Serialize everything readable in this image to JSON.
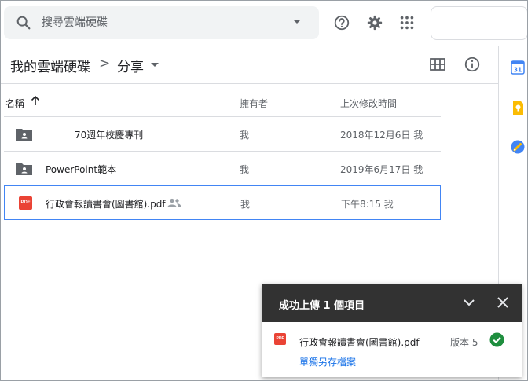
{
  "search": {
    "placeholder": "搜尋雲端硬碟"
  },
  "header": {
    "help_icon": "help-circle-icon",
    "settings_icon": "gear-icon",
    "apps_icon": "apps-grid-icon"
  },
  "breadcrumb": {
    "root": "我的雲端硬碟",
    "separator": ">",
    "current": "分享"
  },
  "columns": {
    "name": "名稱",
    "owner": "擁有者",
    "modified": "上次修改時間"
  },
  "files": [
    {
      "type": "shared-folder",
      "name": "70週年校慶專刊",
      "owner": "我",
      "modified": "2018年12月6日 我"
    },
    {
      "type": "shared-folder",
      "name": "PowerPoint範本",
      "owner": "我",
      "modified": "2019年6月17日 我"
    },
    {
      "type": "pdf",
      "name": "行政會報讀書會(圖書館).pdf",
      "owner": "我",
      "modified": "下午8:15 我",
      "shared": true
    }
  ],
  "pdf_badge": "PDF",
  "side_panel": [
    "calendar-icon",
    "keep-icon",
    "tasks-icon"
  ],
  "upload_toast": {
    "title": "成功上傳 1 個項目",
    "file_name": "行政會報讀書會(圖書館).pdf",
    "version": "版本 5",
    "save_link": "單獨另存檔案"
  },
  "colors": {
    "accent": "#1a73e8",
    "pdf": "#ea4335",
    "success": "#1e8e3e",
    "toast_header": "#323232"
  }
}
